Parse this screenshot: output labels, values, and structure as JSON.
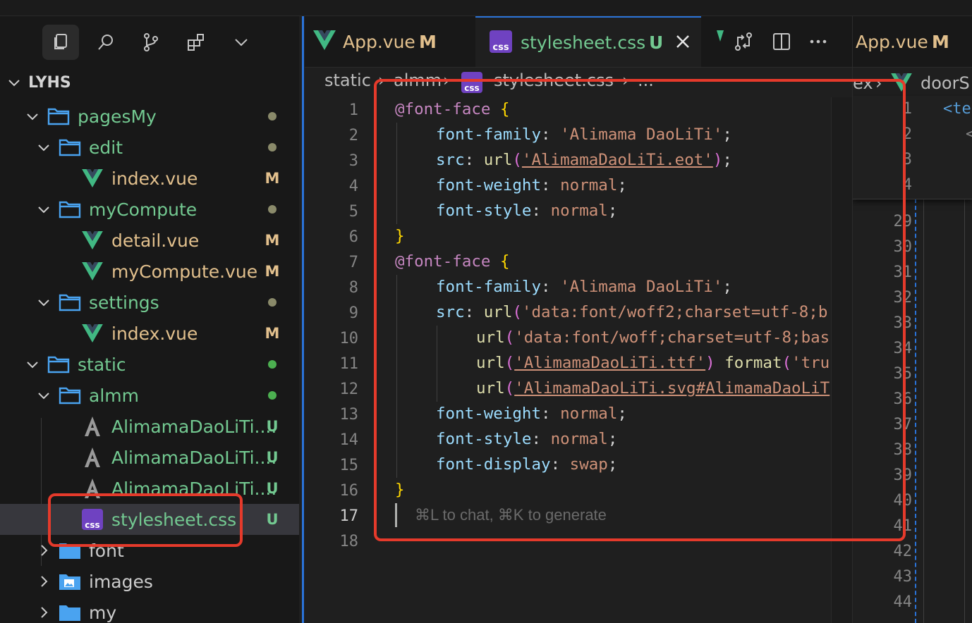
{
  "explorer": {
    "root": "LYHS",
    "rows": [
      {
        "label": "pagesMy",
        "type": "folder",
        "status": "",
        "color": "#73c991"
      },
      {
        "label": "edit",
        "type": "folder",
        "status": "",
        "color": "#73c991"
      },
      {
        "label": "index.vue",
        "type": "vue",
        "status": "M",
        "color": "#e2c08d"
      },
      {
        "label": "myCompute",
        "type": "folder",
        "status": "",
        "color": "#73c991"
      },
      {
        "label": "detail.vue",
        "type": "vue",
        "status": "M",
        "color": "#e2c08d"
      },
      {
        "label": "myCompute.vue",
        "type": "vue",
        "status": "M",
        "color": "#e2c08d"
      },
      {
        "label": "settings",
        "type": "folder",
        "status": "",
        "color": "#73c991"
      },
      {
        "label": "index.vue",
        "type": "vue",
        "status": "M",
        "color": "#e2c08d"
      },
      {
        "label": "static",
        "type": "folder",
        "status": "",
        "color": "#73c991"
      },
      {
        "label": "almm",
        "type": "folder",
        "status": "",
        "color": "#73c991"
      },
      {
        "label": "AlimamaDaoLiTi....",
        "type": "font",
        "status": "U",
        "color": "#73c991"
      },
      {
        "label": "AlimamaDaoLiTi....",
        "type": "font",
        "status": "U",
        "color": "#73c991"
      },
      {
        "label": "AlimamaDaoLiTi....",
        "type": "font",
        "status": "U",
        "color": "#73c991"
      },
      {
        "label": "stylesheet.css",
        "type": "css",
        "status": "U",
        "color": "#73c991"
      },
      {
        "label": "font",
        "type": "folder",
        "status": "",
        "color": "#cccccc"
      },
      {
        "label": "images",
        "type": "folder",
        "status": "",
        "color": "#cccccc"
      },
      {
        "label": "my",
        "type": "folder",
        "status": "",
        "color": "#cccccc"
      }
    ]
  },
  "tabs": [
    {
      "name": "App.vue",
      "status": "M"
    },
    {
      "name": "stylesheet.css",
      "status": "U"
    }
  ],
  "right_tab": {
    "name": "App.vue",
    "status": "M"
  },
  "breadcrumb": {
    "p1": "static",
    "p2": "almm",
    "p3": "stylesheet.css",
    "p4": "...",
    "right_p1": "ex",
    "right_p2": "doorS"
  },
  "editor": {
    "line_numbers": [
      "1",
      "2",
      "3",
      "4",
      "5",
      "6",
      "7",
      "8",
      "9",
      "10",
      "11",
      "12",
      "13",
      "14",
      "15",
      "16",
      "17",
      "18"
    ],
    "hint": "⌘L to chat, ⌘K to generate",
    "code": {
      "at_font_face": "@font-face",
      "open": "{",
      "close": "}",
      "font_family": "font-family",
      "family_value": "'Alimama DaoLiTi'",
      "src": "src",
      "url": "url",
      "eot": "'AlimamaDaoLiTi.eot'",
      "font_weight": "font-weight",
      "font_style": "font-style",
      "normal": "normal",
      "woff2": "'data:font/woff2;charset=utf-8;b",
      "woff": "'data:font/woff;charset=utf-8;bas",
      "ttf": "'AlimamaDaoLiTi.ttf'",
      "format": "format",
      "format_arg": "'tru",
      "svg": "'AlimamaDaoLiTi.svg#AlimamaDaoLiT",
      "font_display": "font-display",
      "swap": "swap"
    }
  },
  "right_editor": {
    "top_lines": [
      "1",
      "2",
      "3",
      "4"
    ],
    "top_code": [
      "<te",
      "<"
    ],
    "lines": [
      "29",
      "30",
      "31",
      "32",
      "33",
      "34",
      "35",
      "36",
      "37",
      "38",
      "39",
      "40",
      "41",
      "42",
      "43",
      "44"
    ]
  }
}
